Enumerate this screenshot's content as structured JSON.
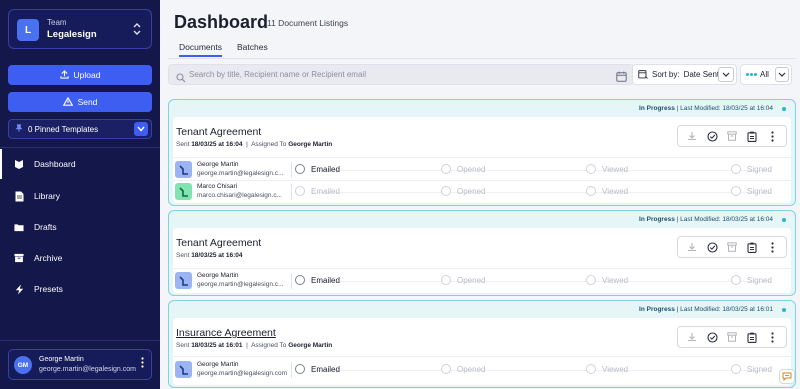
{
  "team": {
    "label": "Team",
    "name": "Legalesign",
    "initial": "L"
  },
  "actions": {
    "upload": "Upload",
    "send": "Send"
  },
  "pinned": {
    "label": "0 Pinned Templates"
  },
  "nav": [
    {
      "label": "Dashboard",
      "icon": "dashboard-icon",
      "active": true
    },
    {
      "label": "Library",
      "icon": "library-icon"
    },
    {
      "label": "Drafts",
      "icon": "drafts-icon"
    },
    {
      "label": "Archive",
      "icon": "archive-icon"
    },
    {
      "label": "Presets",
      "icon": "presets-icon"
    }
  ],
  "user": {
    "initials": "GM",
    "name": "George Martin",
    "email": "george.martin@legalesign.com"
  },
  "header": {
    "title": "Dashboard",
    "subtitle": "11 Document Listings"
  },
  "tabs": [
    {
      "label": "Documents",
      "active": true
    },
    {
      "label": "Batches"
    }
  ],
  "search": {
    "placeholder": "Search by title, Recipient name or Recipient email",
    "value": ""
  },
  "sort": {
    "label": "Sort by:",
    "value": "Date Sent"
  },
  "filter": {
    "value": "All"
  },
  "documents": [
    {
      "status": "In Progress",
      "modified": "Last Modified: 18/03/25 at 16:04",
      "title": "Tenant Agreement",
      "sent_label": "Sent",
      "sent": "18/03/25 at 16:04",
      "assigned_label": "Assigned To",
      "assigned": "George Martin",
      "recipients": [
        {
          "name": "George Martin",
          "email": "george.martin@legalesign.c...",
          "color": "#9db4f2"
        },
        {
          "name": "Marco Chisari",
          "email": "marco.chisari@legalesign.c...",
          "color": "#7fe3b2"
        }
      ]
    },
    {
      "status": "In Progress",
      "modified": "Last Modified: 18/03/25 at 16:04",
      "title": "Tenant Agreement",
      "sent_label": "Sent",
      "sent": "18/03/25 at 16:04",
      "recipients": [
        {
          "name": "George Martin",
          "email": "george.martin@legalesign.c...",
          "color": "#9db4f2"
        }
      ]
    },
    {
      "status": "In Progress",
      "modified": "Last Modified: 18/03/25 at 16:01",
      "title": "Insurance Agreement",
      "sent_label": "Sent",
      "sent": "18/03/25 at 16:01",
      "assigned_label": "Assigned To",
      "assigned": "George Martin",
      "recipients": [
        {
          "name": "George Martin",
          "email": "george.martin@legalesign.com",
          "color": "#9db4f2"
        }
      ]
    }
  ],
  "steps": [
    "Emailed",
    "Opened",
    "Viewed",
    "Signed"
  ],
  "colors": {
    "sidebar": "#13174a",
    "accent": "#3d5ef0",
    "card_border": "#7fd3df",
    "status_dot": "#29b7c7"
  }
}
